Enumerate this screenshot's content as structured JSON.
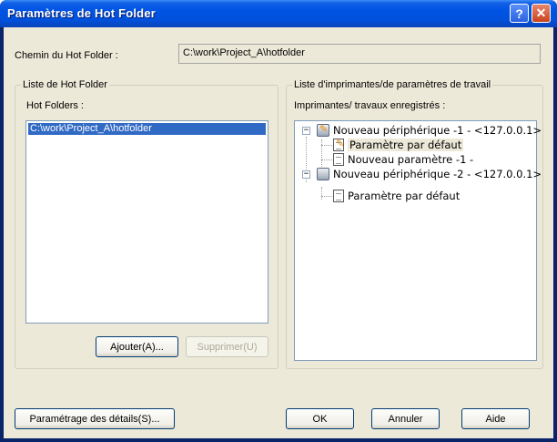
{
  "window": {
    "title": "Paramètres de Hot Folder",
    "help_glyph": "?",
    "close_glyph": "✕"
  },
  "path": {
    "label": "Chemin du Hot Folder :",
    "value": "C:\\work\\Project_A\\hotfolder"
  },
  "left_group": {
    "title": "Liste de Hot Folder",
    "list_label": "Hot Folders :",
    "items": [
      "C:\\work\\Project_A\\hotfolder"
    ],
    "add_button": "Ajouter(A)...",
    "remove_button": "Supprimer(U)"
  },
  "right_group": {
    "title": "Liste d'imprimantes/de paramètres de travail",
    "list_label": "Imprimantes/ travaux enregistrés :",
    "tree": {
      "device1": "Nouveau périphérique -1 - <127.0.0.1>",
      "device1_child1": "Paramètre par défaut",
      "device1_child2": "Nouveau paramètre -1 -",
      "device2": "Nouveau périphérique -2 - <127.0.0.1>",
      "device2_child1": "Paramètre par défaut"
    }
  },
  "footer": {
    "details_button": "Paramétrage des détails(S)...",
    "ok_button": "OK",
    "cancel_button": "Annuler",
    "help_button": "Aide"
  },
  "colors": {
    "titlebar": "#0054e3",
    "face": "#ece9d8",
    "selection": "#316ac5"
  }
}
